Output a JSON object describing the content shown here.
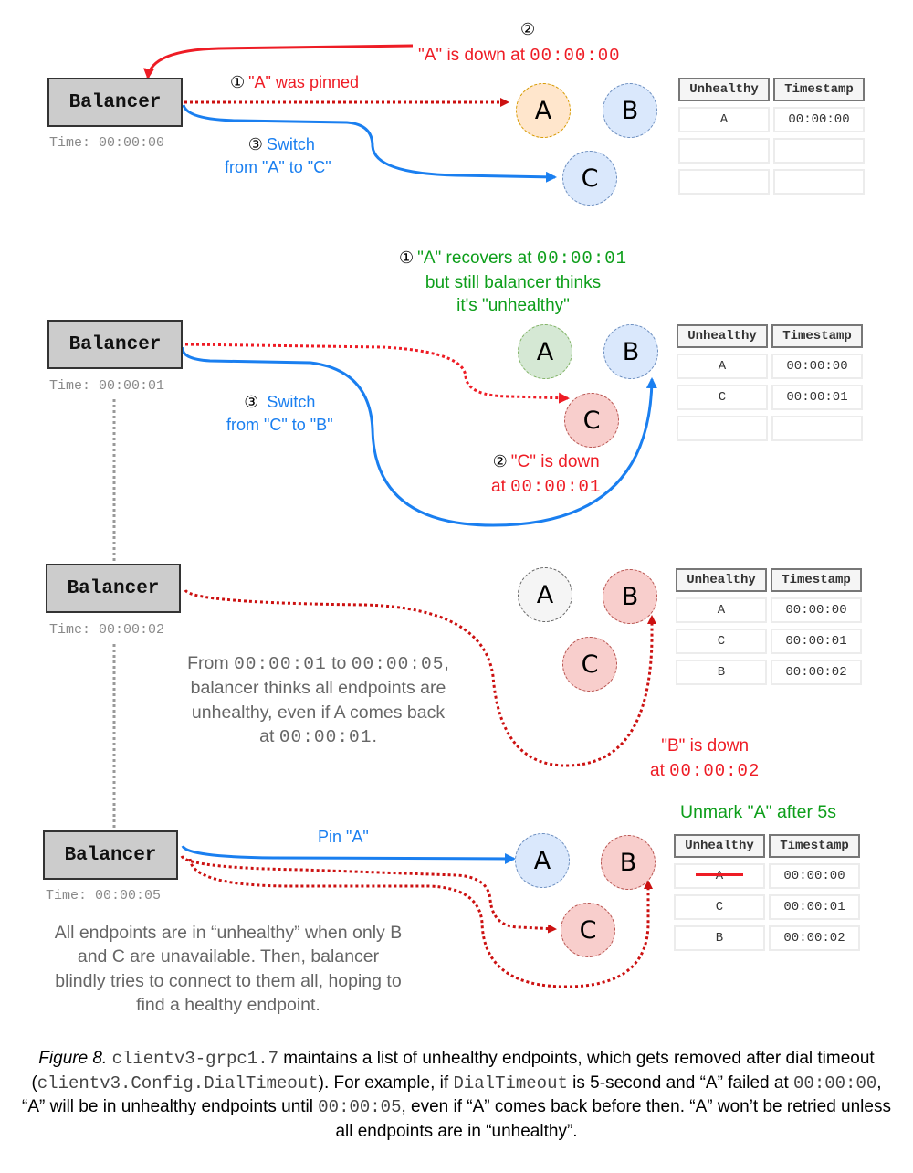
{
  "balancer_label": "Balancer",
  "colors": {
    "error_red": "#ee1c25",
    "dotted_red": "#cc1111",
    "switch_blue": "#1a7ff0",
    "recover_green": "#0d9e1a",
    "note_gray": "#666666",
    "node_blue": "#dae8fc",
    "node_orange": "#ffe6cc",
    "node_green": "#d5e8d4",
    "node_red": "#f8cecc",
    "node_gray": "#f5f5f5"
  },
  "table_headers": {
    "unhealthy": "Unhealthy",
    "timestamp": "Timestamp"
  },
  "panels": [
    {
      "time_label": "Time: 00:00:00",
      "nodes": [
        {
          "name": "A",
          "state": "pinned"
        },
        {
          "name": "B",
          "state": "normal"
        },
        {
          "name": "C",
          "state": "normal"
        }
      ],
      "annotations": {
        "step1_marker": "①",
        "step1_text": "\"A\" was pinned",
        "step2_marker": "②",
        "step2_text": "\"A\" is down at ",
        "step2_time": "00:00:00",
        "step3_marker": "③",
        "step3_line1": "Switch",
        "step3_line2": "from \"A\" to \"C\""
      },
      "table_rows": [
        {
          "unhealthy": "A",
          "timestamp": "00:00:00",
          "struck": false
        },
        {
          "unhealthy": "",
          "timestamp": "",
          "struck": false
        },
        {
          "unhealthy": "",
          "timestamp": "",
          "struck": false
        }
      ]
    },
    {
      "time_label": "Time: 00:00:01",
      "nodes": [
        {
          "name": "A",
          "state": "recovered"
        },
        {
          "name": "B",
          "state": "normal"
        },
        {
          "name": "C",
          "state": "down"
        }
      ],
      "annotations": {
        "step1_marker": "①",
        "step1_text": "\"A\" recovers at ",
        "step1_time": "00:00:01",
        "step1_line2": "but still balancer thinks",
        "step1_line3": "it's \"unhealthy\"",
        "step2_marker": "②",
        "step2_line1": "\"C\" is down",
        "step2_prefix": "at ",
        "step2_time": "00:00:01",
        "step3_marker": "③",
        "step3_line1": "Switch",
        "step3_line2": "from \"C\" to \"B\""
      },
      "table_rows": [
        {
          "unhealthy": "A",
          "timestamp": "00:00:00",
          "struck": false
        },
        {
          "unhealthy": "C",
          "timestamp": "00:00:01",
          "struck": false
        },
        {
          "unhealthy": "",
          "timestamp": "",
          "struck": false
        }
      ]
    },
    {
      "time_label": "Time: 00:00:02",
      "nodes": [
        {
          "name": "A",
          "state": "unknown"
        },
        {
          "name": "B",
          "state": "down"
        },
        {
          "name": "C",
          "state": "down"
        }
      ],
      "annotations": {
        "down_line1": "\"B\" is down",
        "down_prefix": "at ",
        "down_time": "00:00:02"
      },
      "note": {
        "l1_a": "From ",
        "l1_t1": "00:00:01",
        "l1_b": " to ",
        "l1_t2": "00:00:05",
        "l1_c": ",",
        "l2": "balancer thinks all endpoints are",
        "l3": "unhealthy, even if A comes back",
        "l4_a": "at ",
        "l4_t": "00:00:01",
        "l4_b": "."
      },
      "table_rows": [
        {
          "unhealthy": "A",
          "timestamp": "00:00:00",
          "struck": false
        },
        {
          "unhealthy": "C",
          "timestamp": "00:00:01",
          "struck": false
        },
        {
          "unhealthy": "B",
          "timestamp": "00:00:02",
          "struck": false
        }
      ]
    },
    {
      "time_label": "Time: 00:00:05",
      "nodes": [
        {
          "name": "A",
          "state": "normal"
        },
        {
          "name": "B",
          "state": "down"
        },
        {
          "name": "C",
          "state": "down"
        }
      ],
      "annotations": {
        "pin_text": "Pin \"A\"",
        "unmark_text": "Unmark \"A\" after 5s"
      },
      "note": {
        "l1": "All endpoints are in “unhealthy” when only B",
        "l2": "and C are unavailable. Then, balancer",
        "l3": "blindly tries to connect to them all, hoping to",
        "l4": "find a healthy endpoint."
      },
      "table_rows": [
        {
          "unhealthy": "A",
          "timestamp": "00:00:00",
          "struck": true
        },
        {
          "unhealthy": "C",
          "timestamp": "00:00:01",
          "struck": false
        },
        {
          "unhealthy": "B",
          "timestamp": "00:00:02",
          "struck": false
        }
      ]
    }
  ],
  "caption": {
    "figure_label": "Figure 8.",
    "code1": "clientv3-grpc1.7",
    "text1": " maintains a list of unhealthy endpoints, which gets removed after dial timeout (",
    "code2": "clientv3.Config.DialTimeout",
    "text2": "). For example, if ",
    "code3": "DialTimeout",
    "text3": " is 5-second and “A” failed at ",
    "code4": "00:00:00",
    "text4": ", “A” will be in unhealthy endpoints until ",
    "code5": "00:00:05",
    "text5": ", even if “A” comes back before then. “A” won’t be retried unless all endpoints are in “unhealthy”."
  }
}
